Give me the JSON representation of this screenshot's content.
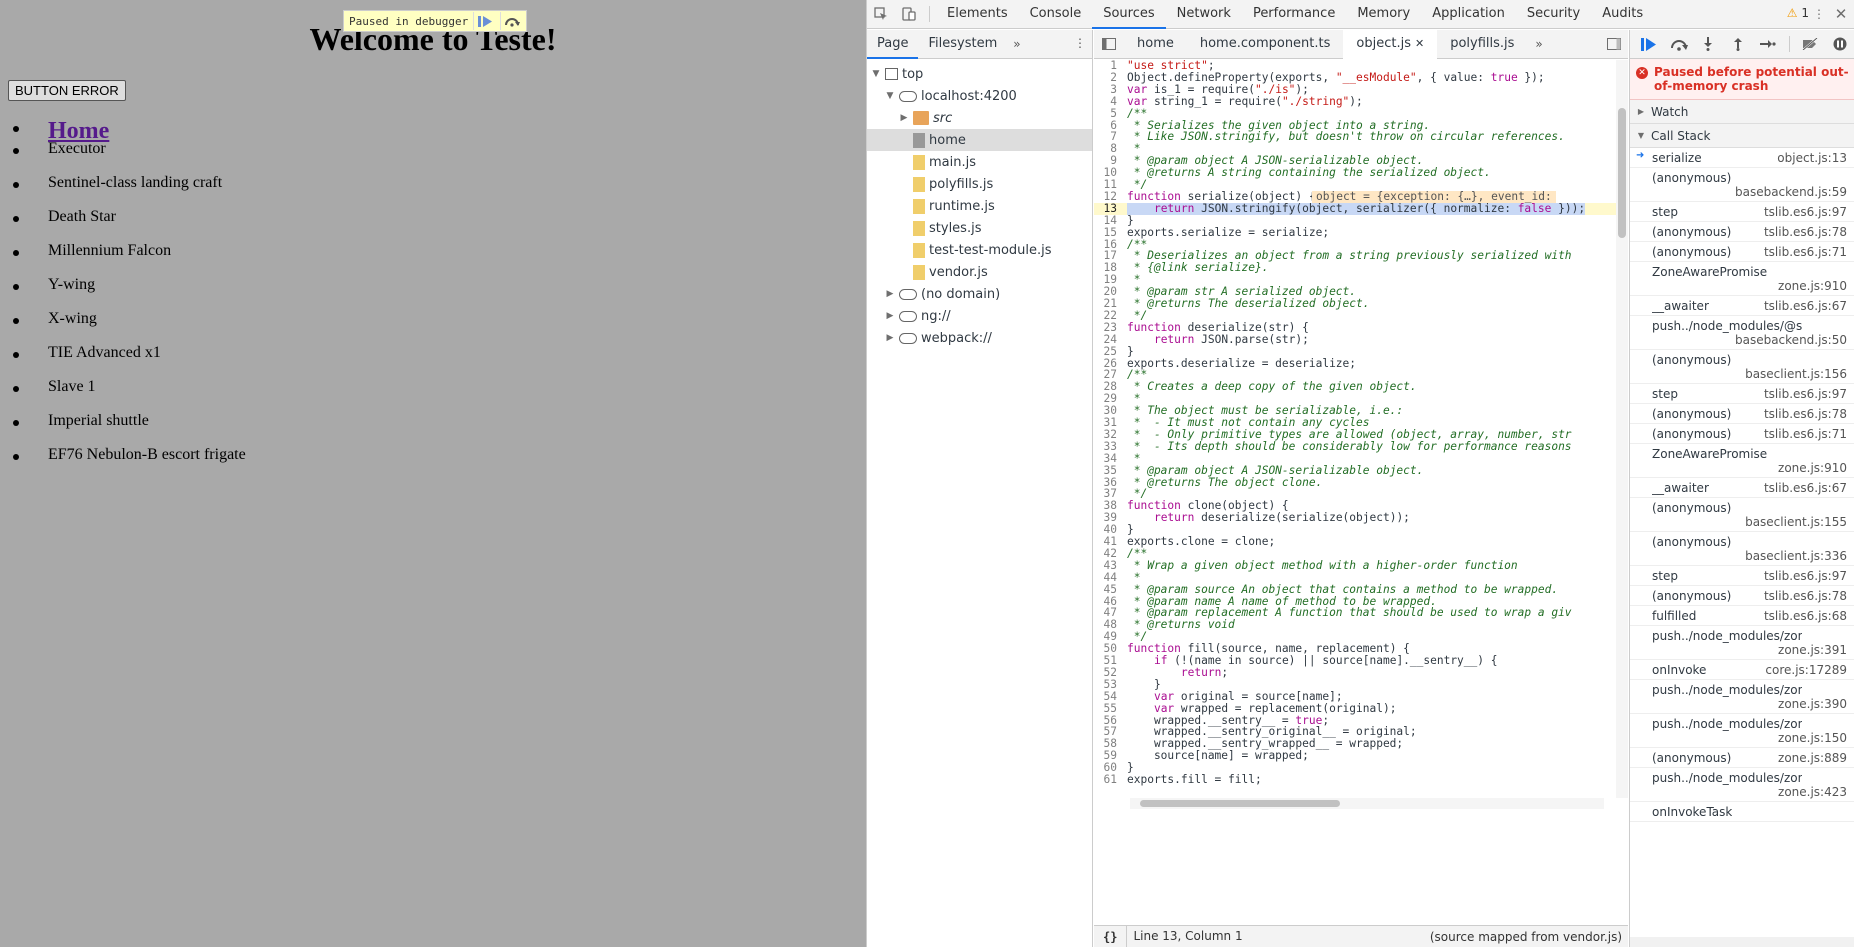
{
  "page": {
    "title": "Welcome to Teste!",
    "button": "BUTTON ERROR",
    "home_link": "Home",
    "items": [
      "Executor",
      "Sentinel-class landing craft",
      "Death Star",
      "Millennium Falcon",
      "Y-wing",
      "X-wing",
      "TIE Advanced x1",
      "Slave 1",
      "Imperial shuttle",
      "EF76 Nebulon-B escort frigate"
    ],
    "paused_overlay": "Paused in debugger"
  },
  "devtools": {
    "tabs": [
      "Elements",
      "Console",
      "Sources",
      "Network",
      "Performance",
      "Memory",
      "Application",
      "Security",
      "Audits"
    ],
    "active_tab": "Sources",
    "warning_count": "1",
    "navigator": {
      "tabs": [
        "Page",
        "Filesystem"
      ],
      "tree": [
        {
          "label": "top",
          "depth": 0,
          "icon": "frame",
          "expanded": true
        },
        {
          "label": "localhost:4200",
          "depth": 1,
          "icon": "cloud",
          "expanded": true
        },
        {
          "label": "src",
          "depth": 2,
          "icon": "folder-orange",
          "expanded": false,
          "italic": true
        },
        {
          "label": "home",
          "depth": 2,
          "icon": "file-grey",
          "selected": true
        },
        {
          "label": "main.js",
          "depth": 2,
          "icon": "file"
        },
        {
          "label": "polyfills.js",
          "depth": 2,
          "icon": "file"
        },
        {
          "label": "runtime.js",
          "depth": 2,
          "icon": "file"
        },
        {
          "label": "styles.js",
          "depth": 2,
          "icon": "file"
        },
        {
          "label": "test-test-module.js",
          "depth": 2,
          "icon": "file"
        },
        {
          "label": "vendor.js",
          "depth": 2,
          "icon": "file"
        },
        {
          "label": "(no domain)",
          "depth": 1,
          "icon": "cloud",
          "expanded": false
        },
        {
          "label": "ng://",
          "depth": 1,
          "icon": "cloud",
          "expanded": false
        },
        {
          "label": "webpack://",
          "depth": 1,
          "icon": "cloud",
          "expanded": false
        }
      ]
    },
    "editor_tabs": [
      {
        "label": "home",
        "active": false
      },
      {
        "label": "home.component.ts",
        "active": false
      },
      {
        "label": "object.js",
        "active": true,
        "closable": true
      },
      {
        "label": "polyfills.js",
        "active": false
      }
    ],
    "inline_value": "object = {exception: {…}, event_id:",
    "status": {
      "position": "Line 13, Column 1",
      "source_map": "(source mapped from vendor.js)"
    },
    "debugger": {
      "paused_message": "Paused before potential out-of-memory crash",
      "watch_label": "Watch",
      "callstack_label": "Call Stack",
      "frames": [
        {
          "fn": "serialize",
          "loc": "object.js:13",
          "inline": true,
          "current": true
        },
        {
          "fn": "(anonymous)",
          "loc": "basebackend.js:59"
        },
        {
          "fn": "step",
          "loc": "tslib.es6.js:97",
          "inline": true
        },
        {
          "fn": "(anonymous)",
          "loc": "tslib.es6.js:78",
          "inline": true
        },
        {
          "fn": "(anonymous)",
          "loc": "tslib.es6.js:71",
          "inline": true
        },
        {
          "fn": "ZoneAwarePromise",
          "loc": "zone.js:910"
        },
        {
          "fn": "__awaiter",
          "loc": "tslib.es6.js:67",
          "inline": true
        },
        {
          "fn": "push../node_modules/@se...",
          "loc": "basebackend.js:50"
        },
        {
          "fn": "(anonymous)",
          "loc": "baseclient.js:156"
        },
        {
          "fn": "step",
          "loc": "tslib.es6.js:97",
          "inline": true
        },
        {
          "fn": "(anonymous)",
          "loc": "tslib.es6.js:78",
          "inline": true
        },
        {
          "fn": "(anonymous)",
          "loc": "tslib.es6.js:71",
          "inline": true
        },
        {
          "fn": "ZoneAwarePromise",
          "loc": "zone.js:910"
        },
        {
          "fn": "__awaiter",
          "loc": "tslib.es6.js:67",
          "inline": true
        },
        {
          "fn": "(anonymous)",
          "loc": "baseclient.js:155"
        },
        {
          "fn": "(anonymous)",
          "loc": "baseclient.js:336"
        },
        {
          "fn": "step",
          "loc": "tslib.es6.js:97",
          "inline": true
        },
        {
          "fn": "(anonymous)",
          "loc": "tslib.es6.js:78",
          "inline": true
        },
        {
          "fn": "fulfilled",
          "loc": "tslib.es6.js:68",
          "inline": true
        },
        {
          "fn": "push../node_modules/zone....",
          "loc": "zone.js:391"
        },
        {
          "fn": "onInvoke",
          "loc": "core.js:17289",
          "inline": true
        },
        {
          "fn": "push../node_modules/zone....",
          "loc": "zone.js:390"
        },
        {
          "fn": "push../node_modules/zone....",
          "loc": "zone.js:150"
        },
        {
          "fn": "(anonymous)",
          "loc": "zone.js:889",
          "inline": true
        },
        {
          "fn": "push../node_modules/zone....",
          "loc": "zone.js:423"
        },
        {
          "fn": "onInvokeTask",
          "loc": ""
        }
      ]
    },
    "code": [
      "\"use strict\";",
      "Object.defineProperty(exports, \"__esModule\", { value: true });",
      "var is_1 = require(\"./is\");",
      "var string_1 = require(\"./string\");",
      "/**",
      " * Serializes the given object into a string.",
      " * Like JSON.stringify, but doesn't throw on circular references.",
      " *",
      " * @param object A JSON-serializable object.",
      " * @returns A string containing the serialized object.",
      " */",
      "function serialize(object) {",
      "    return JSON.stringify(object, serializer({ normalize: false }));",
      "}",
      "exports.serialize = serialize;",
      "/**",
      " * Deserializes an object from a string previously serialized with",
      " * {@link serialize}.",
      " *",
      " * @param str A serialized object.",
      " * @returns The deserialized object.",
      " */",
      "function deserialize(str) {",
      "    return JSON.parse(str);",
      "}",
      "exports.deserialize = deserialize;",
      "/**",
      " * Creates a deep copy of the given object.",
      " *",
      " * The object must be serializable, i.e.:",
      " *  - It must not contain any cycles",
      " *  - Only primitive types are allowed (object, array, number, str",
      " *  - Its depth should be considerably low for performance reasons",
      " *",
      " * @param object A JSON-serializable object.",
      " * @returns The object clone.",
      " */",
      "function clone(object) {",
      "    return deserialize(serialize(object));",
      "}",
      "exports.clone = clone;",
      "/**",
      " * Wrap a given object method with a higher-order function",
      " *",
      " * @param source An object that contains a method to be wrapped.",
      " * @param name A name of method to be wrapped.",
      " * @param replacement A function that should be used to wrap a giv",
      " * @returns void",
      " */",
      "function fill(source, name, replacement) {",
      "    if (!(name in source) || source[name].__sentry__) {",
      "        return;",
      "    }",
      "    var original = source[name];",
      "    var wrapped = replacement(original);",
      "    wrapped.__sentry__ = true;",
      "    wrapped.__sentry_original__ = original;",
      "    wrapped.__sentry_wrapped__ = wrapped;",
      "    source[name] = wrapped;",
      "}",
      "exports.fill = fill;"
    ],
    "current_line": 13
  }
}
